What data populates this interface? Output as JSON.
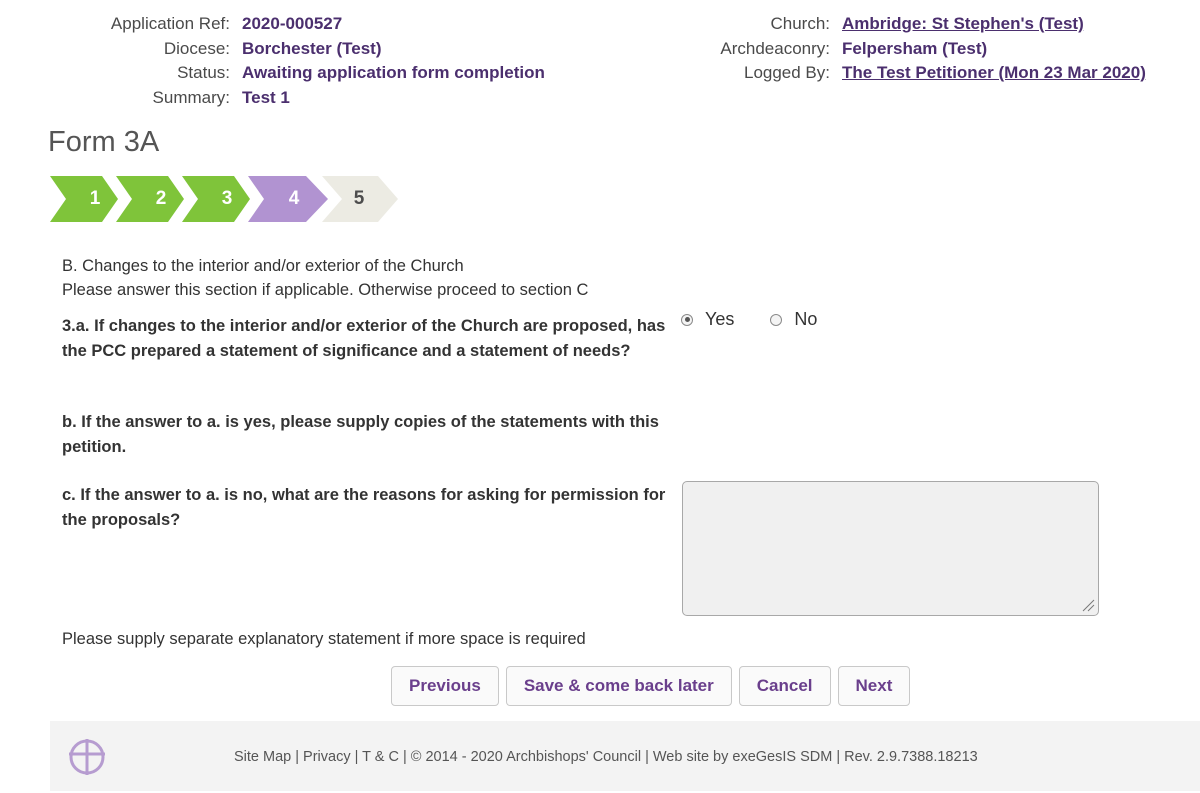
{
  "meta": {
    "left": [
      {
        "label": "Application Ref:",
        "value": "2020-000527"
      },
      {
        "label": "Diocese:",
        "value": "Borchester (Test)"
      },
      {
        "label": "Status:",
        "value": "Awaiting application form completion"
      },
      {
        "label": "Summary:",
        "value": "Test 1"
      }
    ],
    "right": [
      {
        "label": "Church:",
        "value": "Ambridge: St Stephen's (Test)"
      },
      {
        "label": "Archdeaconry:",
        "value": "Felpersham (Test)"
      },
      {
        "label": "Logged By:",
        "value": "The Test Petitioner (Mon 23 Mar 2020)"
      }
    ]
  },
  "form_title": "Form 3A",
  "steps": {
    "labels": [
      "1",
      "2",
      "3",
      "4",
      "5"
    ],
    "states": [
      "done",
      "done",
      "done",
      "current",
      "todo"
    ],
    "colors": {
      "done": "#7fc43a",
      "current": "#b193d1",
      "todo": "#ecebe3"
    }
  },
  "section": {
    "heading": "B. Changes to the interior and/or exterior of the Church",
    "instruction": "Please answer this section if applicable. Otherwise proceed to section C"
  },
  "questions": {
    "a": "3.a. If changes to the interior and/or exterior of the Church are proposed, has the PCC prepared a statement of significance and a statement of needs?",
    "b": "b. If the answer to a. is yes, please supply copies of the statements with this petition.",
    "c": "c. If the answer to a. is no, what are the reasons for asking for permission for the proposals?"
  },
  "radio": {
    "yes_label": "Yes",
    "no_label": "No",
    "selected": "Yes"
  },
  "reasons_value": "",
  "note": "Please supply separate explanatory statement if more space is required",
  "buttons": {
    "previous": "Previous",
    "save": "Save & come back later",
    "cancel": "Cancel",
    "next": "Next"
  },
  "footer": {
    "text": "Site Map | Privacy | T & C | © 2014 - 2020 Archbishops' Council | Web site by exeGesIS SDM | Rev. 2.9.7388.18213",
    "logo_icon": "church-cross-logo-icon"
  }
}
